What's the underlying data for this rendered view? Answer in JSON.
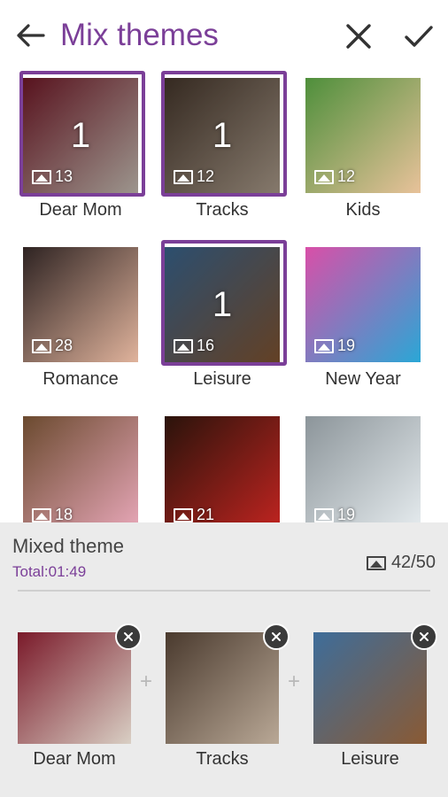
{
  "header": {
    "title": "Mix themes"
  },
  "themes": [
    {
      "label": "Dear Mom",
      "count": "13",
      "selected": true,
      "order": "1",
      "colors": [
        "#7a1a2a",
        "#d9cfc4"
      ]
    },
    {
      "label": "Tracks",
      "count": "12",
      "selected": true,
      "order": "1",
      "colors": [
        "#4a3a2e",
        "#b9a896"
      ]
    },
    {
      "label": "Kids",
      "count": "12",
      "selected": false,
      "order": "",
      "colors": [
        "#4e8f3b",
        "#e8c29a"
      ]
    },
    {
      "label": "Romance",
      "count": "28",
      "selected": false,
      "order": "",
      "colors": [
        "#2e2322",
        "#e0b39c"
      ]
    },
    {
      "label": "Leisure",
      "count": "16",
      "selected": true,
      "order": "1",
      "colors": [
        "#3e6d9a",
        "#8a5a34"
      ]
    },
    {
      "label": "New Year",
      "count": "19",
      "selected": false,
      "order": "",
      "colors": [
        "#d94fa8",
        "#2aa7d6"
      ]
    },
    {
      "label": "",
      "count": "18",
      "selected": false,
      "order": "",
      "colors": [
        "#6b4a2f",
        "#e7a7b8"
      ]
    },
    {
      "label": "",
      "count": "21",
      "selected": false,
      "order": "",
      "colors": [
        "#2a130b",
        "#c02420"
      ]
    },
    {
      "label": "",
      "count": "19",
      "selected": false,
      "order": "",
      "colors": [
        "#8c959a",
        "#e6ecef"
      ]
    }
  ],
  "mixed": {
    "title": "Mixed theme",
    "total": "Total:01:49",
    "count": "42/50",
    "items": [
      {
        "label": "Dear Mom",
        "colors": [
          "#7a1a2a",
          "#d9cfc4"
        ]
      },
      {
        "label": "Tracks",
        "colors": [
          "#4a3a2e",
          "#b9a896"
        ]
      },
      {
        "label": "Leisure",
        "colors": [
          "#3e6d9a",
          "#8a5a34"
        ]
      }
    ],
    "plus": "+"
  },
  "colors": {
    "accent": "#7b3f98",
    "panel_bg": "#ebebeb"
  }
}
